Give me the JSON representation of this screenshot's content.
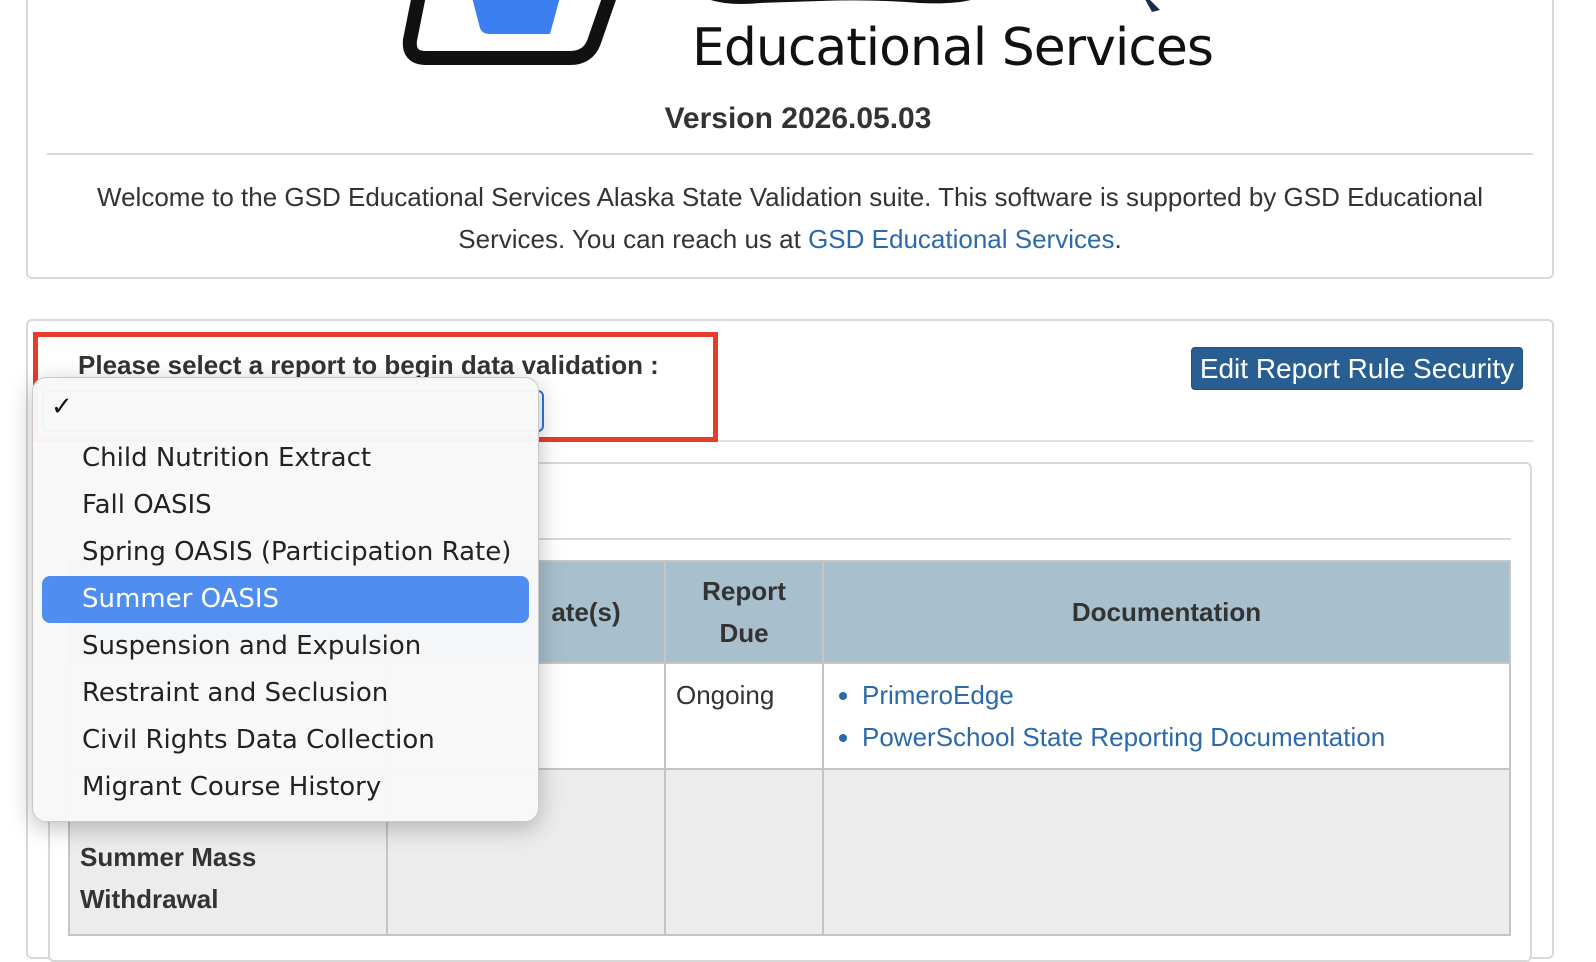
{
  "header": {
    "logo_subtitle": "Educational Services",
    "version": "Version 2026.05.03",
    "welcome_text": "Welcome to the GSD Educational Services Alaska State Validation suite. This software is supported by GSD Educational Services. You can reach us at ",
    "welcome_link": "GSD Educational Services",
    "welcome_end": "."
  },
  "main": {
    "select_label": "Please select a report to begin data validation :",
    "edit_button": "Edit Report Rule Security"
  },
  "dropdown": {
    "checkmark": "✓",
    "options": [
      "Child Nutrition Extract",
      "Fall OASIS",
      "Spring OASIS (Participation Rate)",
      "Summer OASIS",
      "Suspension and Expulsion",
      "Restraint and Seclusion",
      "Civil Rights Data Collection",
      "Migrant Course History"
    ],
    "selected": "Summer OASIS"
  },
  "table": {
    "headers": [
      "",
      "ate(s)",
      "Report Due",
      "Documentation"
    ],
    "rows": [
      {
        "report_due": "Ongoing",
        "docs": [
          "PrimeroEdge",
          "PowerSchool State Reporting Documentation"
        ]
      },
      {
        "name": "Summer Mass Withdrawal"
      }
    ]
  },
  "colors": {
    "accent": "#285e92",
    "link": "#2a6aaa",
    "highlight": "#e63c2a",
    "selected_option": "#4f8ef0",
    "table_header": "#a8bfce"
  }
}
